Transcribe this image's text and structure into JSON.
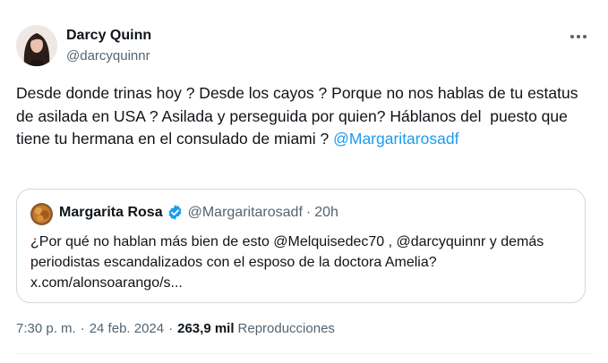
{
  "author": {
    "name": "Darcy Quinn",
    "handle": "@darcyquinnr"
  },
  "tweet": {
    "text": "Desde donde trinas hoy ? Desde los cayos ? Porque no nos hablas de tu estatus de asilada en USA ? Asilada y perseguida por quien? Háblanos del  puesto que tiene tu hermana en el consulado de miami ? ",
    "mention": "@Margaritarosadf"
  },
  "quote": {
    "name": "Margarita Rosa",
    "handle": "@Margaritarosadf",
    "dot": "·",
    "time": "20h",
    "text": "¿Por qué no hablan más bien de esto @Melquisedec70 , @darcyquinnr y demás periodistas escandalizados con el esposo de la doctora Amelia? x.com/alonsoarango/s..."
  },
  "meta": {
    "time": "7:30 p. m.",
    "sep1": "·",
    "date": "24 feb. 2024",
    "sep2": "·",
    "views": "263,9 mil",
    "views_label": "Reproducciones"
  },
  "colors": {
    "link": "#1d9bf0",
    "verified": "#1d9bf0",
    "secondary_text": "#536471",
    "border": "#cfd9de"
  },
  "icons": {
    "more": "more-horizontal-icon",
    "verified": "verified-badge-icon"
  }
}
